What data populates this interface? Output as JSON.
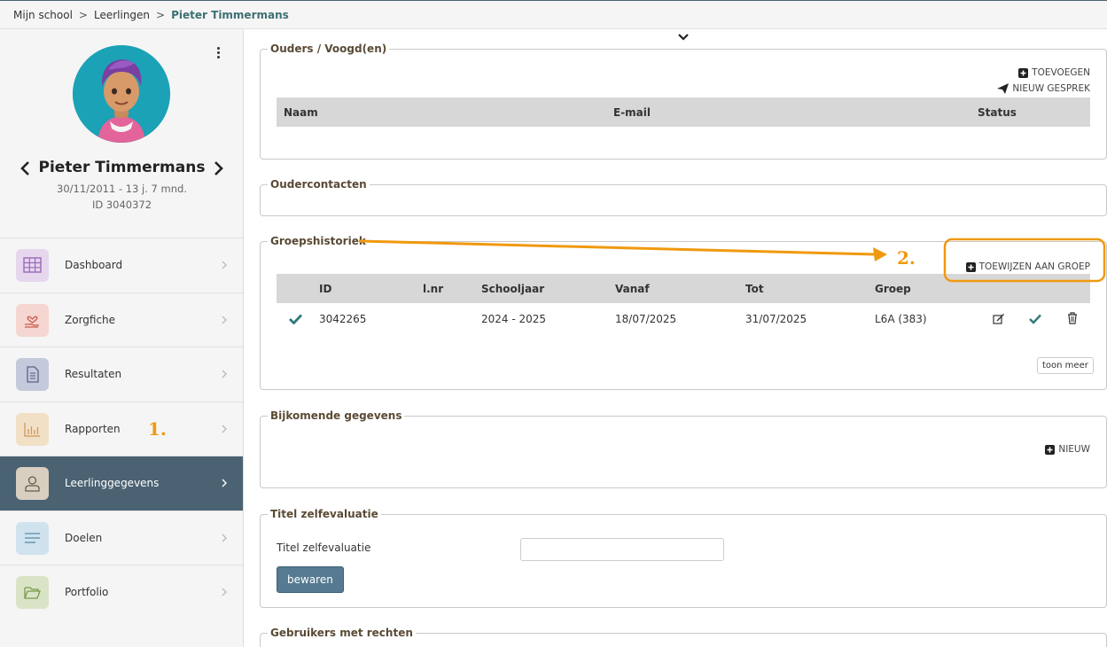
{
  "breadcrumb": {
    "root": "Mijn school",
    "section": "Leerlingen",
    "current": "Pieter Timmermans",
    "separator": ">"
  },
  "student": {
    "name": "Pieter Timmermans",
    "dob": "30/11/2011 - 13 j. 7 mnd.",
    "id": "ID 3040372"
  },
  "menu": [
    {
      "label": "Dashboard",
      "icon": "grid-icon",
      "color": "#e6d6ee"
    },
    {
      "label": "Zorgfiche",
      "icon": "hand-heart-icon",
      "color": "#f5d6d0"
    },
    {
      "label": "Resultaten",
      "icon": "document-icon",
      "color": "#c4c9db"
    },
    {
      "label": "Rapporten",
      "icon": "bar-chart-icon",
      "color": "#f2e0c6"
    },
    {
      "label": "Leerlinggegevens",
      "icon": "user-icon",
      "color": "#d9cfc0"
    },
    {
      "label": "Doelen",
      "icon": "lines-icon",
      "color": "#cfe2ee"
    },
    {
      "label": "Portfolio",
      "icon": "folder-icon",
      "color": "#d9e4c6"
    }
  ],
  "annotations": {
    "one": "1.",
    "two": "2."
  },
  "parents": {
    "title": "Ouders / Voogd(en)",
    "add": "TOEVOEGEN",
    "conversation": "NIEUW GESPREK",
    "columns": [
      "Naam",
      "E-mail",
      "Status"
    ]
  },
  "contacts": {
    "title": "Oudercontacten"
  },
  "history": {
    "title": "Groepshistoriek",
    "assign": "TOEWIJZEN AAN GROEP",
    "columns": [
      "ID",
      "l.nr",
      "Schooljaar",
      "Vanaf",
      "Tot",
      "Groep"
    ],
    "rows": [
      {
        "id": "3042265",
        "lnr": "",
        "year": "2024 - 2025",
        "from": "18/07/2025",
        "to": "31/07/2025",
        "group": "L6A (383)"
      }
    ],
    "more": "toon meer"
  },
  "extra": {
    "title": "Bijkomende gegevens",
    "new": "NIEUW"
  },
  "selfeval": {
    "title": "Titel zelfevaluatie",
    "label": "Titel zelfevaluatie",
    "value": "",
    "save": "bewaren"
  },
  "users": {
    "title": "Gebruikers met rechten"
  },
  "colors": {
    "accent": "#4a6272",
    "annotation": "#f0990f",
    "check": "#2f7a78"
  }
}
